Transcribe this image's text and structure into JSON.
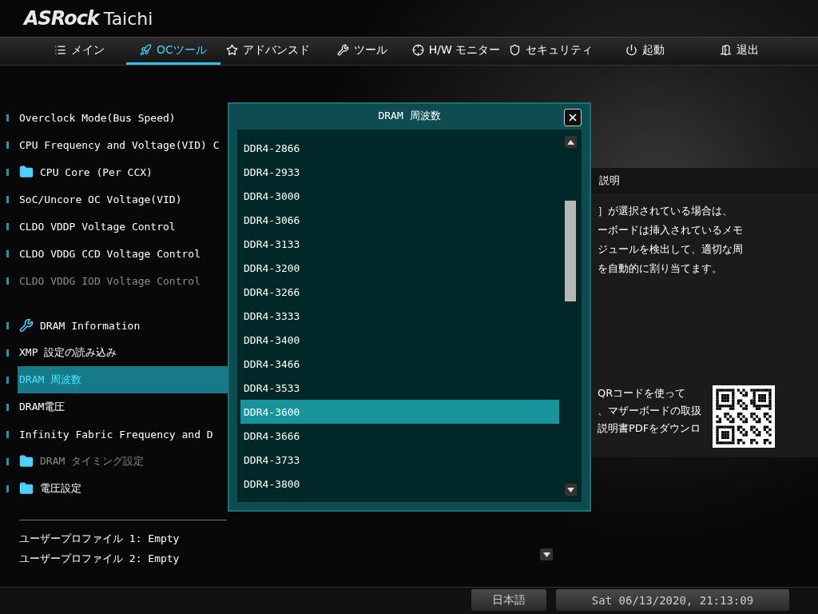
{
  "logo": {
    "brand": "ASRock",
    "model": "Taichi"
  },
  "tabs": [
    {
      "label": "メイン",
      "selected": false
    },
    {
      "label": "OCツール",
      "selected": true
    },
    {
      "label": "アドバンスド",
      "selected": false
    },
    {
      "label": "ツール",
      "selected": false
    },
    {
      "label": "H/W モニター",
      "selected": false
    },
    {
      "label": "セキュリティ",
      "selected": false
    },
    {
      "label": "起動",
      "selected": false
    },
    {
      "label": "退出",
      "selected": false
    }
  ],
  "settings": {
    "groups": [
      [
        {
          "kind": "setting",
          "label": "Overclock Mode(Bus Speed)",
          "selected": false,
          "disabled": false
        },
        {
          "kind": "setting",
          "label": "CPU Frequency and Voltage(VID) C",
          "selected": false,
          "disabled": false
        },
        {
          "kind": "folder",
          "label": "CPU Core (Per CCX)",
          "selected": false,
          "disabled": false
        },
        {
          "kind": "setting",
          "label": "SoC/Uncore OC Voltage(VID)",
          "selected": false,
          "disabled": false
        },
        {
          "kind": "setting",
          "label": "CLDO VDDP Voltage Control",
          "selected": false,
          "disabled": false
        },
        {
          "kind": "setting",
          "label": "CLDO VDDG CCD Voltage Control",
          "selected": false,
          "disabled": false
        },
        {
          "kind": "setting",
          "label": "CLDO VDDG IOD Voltage Control",
          "selected": false,
          "disabled": true
        }
      ],
      [
        {
          "kind": "tool",
          "label": "DRAM Information",
          "selected": false,
          "disabled": false
        },
        {
          "kind": "setting",
          "label": "XMP 設定の読み込み",
          "selected": false,
          "disabled": false
        },
        {
          "kind": "setting",
          "label": "DRAM 周波数",
          "selected": true,
          "disabled": false
        },
        {
          "kind": "setting",
          "label": "DRAM電圧",
          "selected": false,
          "disabled": false
        },
        {
          "kind": "setting",
          "label": "Infinity Fabric Frequency and D",
          "selected": false,
          "disabled": false
        },
        {
          "kind": "folder",
          "label": "DRAM タイミング設定",
          "selected": false,
          "disabled": true
        },
        {
          "kind": "folder",
          "label": "電圧設定",
          "selected": false,
          "disabled": false
        }
      ]
    ],
    "profiles": [
      "ユーザープロファイル 1: Empty",
      "ユーザープロファイル 2: Empty"
    ]
  },
  "help": {
    "title": "説明",
    "lines": [
      "］が選択されている場合は、",
      "ーボードは挿入されているメモ",
      "ジュールを検出して、適切な周",
      "を自動的に割り当てます。"
    ],
    "qr_lines": [
      "QRコードを使って",
      "、マザーボードの取扱",
      "説明書PDFをダウンロ"
    ]
  },
  "dialog": {
    "title": "DRAM 周波数",
    "options": [
      {
        "label": "DDR4-2866",
        "selected": false
      },
      {
        "label": "DDR4-2933",
        "selected": false
      },
      {
        "label": "DDR4-3000",
        "selected": false
      },
      {
        "label": "DDR4-3066",
        "selected": false
      },
      {
        "label": "DDR4-3133",
        "selected": false
      },
      {
        "label": "DDR4-3200",
        "selected": false
      },
      {
        "label": "DDR4-3266",
        "selected": false
      },
      {
        "label": "DDR4-3333",
        "selected": false
      },
      {
        "label": "DDR4-3400",
        "selected": false
      },
      {
        "label": "DDR4-3466",
        "selected": false
      },
      {
        "label": "DDR4-3533",
        "selected": false
      },
      {
        "label": "DDR4-3600",
        "selected": true
      },
      {
        "label": "DDR4-3666",
        "selected": false
      },
      {
        "label": "DDR4-3733",
        "selected": false
      },
      {
        "label": "DDR4-3800",
        "selected": false
      }
    ]
  },
  "status_bar": {
    "language": "日本語",
    "datetime": "Sat 06/13/2020, 21:13:09"
  }
}
